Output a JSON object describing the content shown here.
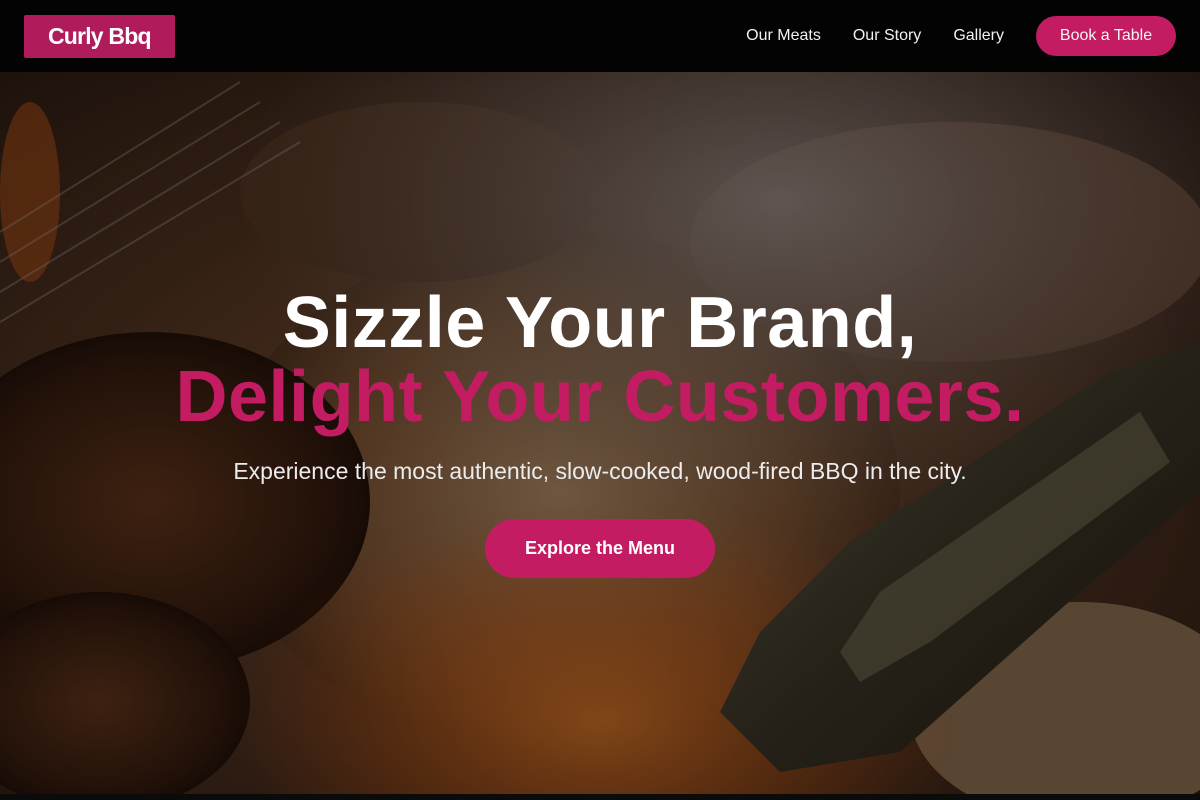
{
  "header": {
    "logo": "Curly Bbq",
    "nav": [
      "Our Meats",
      "Our Story",
      "Gallery"
    ],
    "cta_label": "Book a Table"
  },
  "hero": {
    "headline_line1": "Sizzle Your Brand,",
    "headline_line2": "Delight Your Customers.",
    "subtitle": "Experience the most authentic, slow-cooked, wood-fired BBQ in the city.",
    "cta_label": "Explore the Menu",
    "background_image": "grilled-meat-with-tongs-photo"
  },
  "colors": {
    "accent": "#c41c62",
    "logo_bg": "#b01c5b",
    "header_bg": "#030303"
  }
}
